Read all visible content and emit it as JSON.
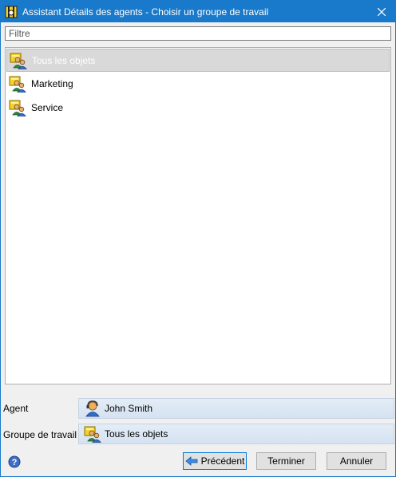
{
  "window": {
    "title": "Assistant Détails des agents - Choisir un groupe de travail",
    "app_icon": "wizard-icon",
    "close_icon": "close-icon",
    "title_bar_color": "#1979ca"
  },
  "filter": {
    "placeholder": "Filtre",
    "value": ""
  },
  "workgroups": {
    "selected_index": 0,
    "items": [
      {
        "label": "Tous les objets",
        "icon": "workgroup-icon"
      },
      {
        "label": "Marketing",
        "icon": "workgroup-icon"
      },
      {
        "label": "Service",
        "icon": "workgroup-icon"
      }
    ]
  },
  "summary": {
    "agent": {
      "label": "Agent",
      "value": "John Smith",
      "icon": "agent-headset-icon"
    },
    "workgroup": {
      "label": "Groupe de travail",
      "value": "Tous les objets",
      "icon": "workgroup-icon"
    }
  },
  "buttons": {
    "help_icon": "help-icon",
    "previous": "Précédent",
    "finish": "Terminer",
    "cancel": "Annuler"
  }
}
